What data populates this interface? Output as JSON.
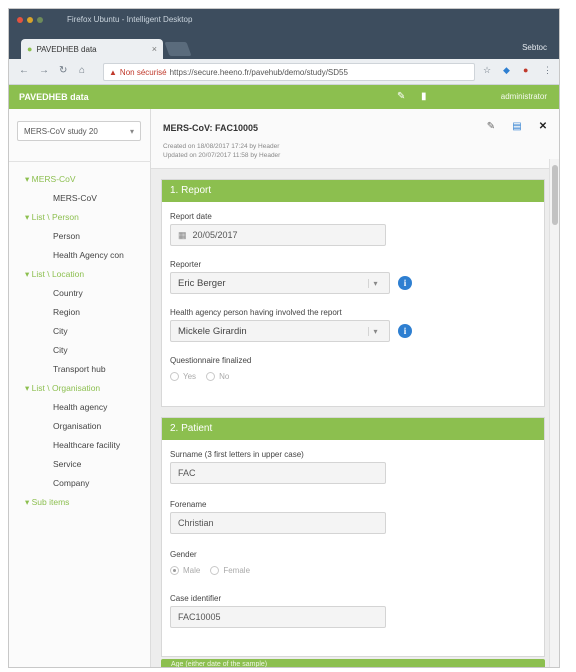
{
  "browser": {
    "window_title": "Firefox Ubuntu - Intelligent Desktop",
    "tab_title": "PAVEDHEB data",
    "profile": "Sebtoc",
    "secure_label": "Non sécurisé",
    "url": "https://secure.heeno.fr/pavehub/demo/study/SD55",
    "colors": {
      "chrome": "#3d4d5e",
      "accent": "#8cbf4f",
      "info": "#2e7fd1"
    }
  },
  "app": {
    "name": "PAVEDHEB data",
    "user": "administrator"
  },
  "sidebar": {
    "study": "MERS-CoV study 20",
    "items": [
      {
        "label": "MERS-CoV",
        "kind": "group"
      },
      {
        "label": "MERS-CoV",
        "kind": "child"
      },
      {
        "label": "List \\ Person",
        "kind": "group"
      },
      {
        "label": "Person",
        "kind": "child"
      },
      {
        "label": "Health Agency con",
        "kind": "child"
      },
      {
        "label": "List \\ Location",
        "kind": "group"
      },
      {
        "label": "Country",
        "kind": "child"
      },
      {
        "label": "Region",
        "kind": "child"
      },
      {
        "label": "City",
        "kind": "child"
      },
      {
        "label": "City",
        "kind": "child"
      },
      {
        "label": "Transport hub",
        "kind": "child"
      },
      {
        "label": "List \\ Organisation",
        "kind": "group"
      },
      {
        "label": "Health agency",
        "kind": "child"
      },
      {
        "label": "Organisation",
        "kind": "child"
      },
      {
        "label": "Healthcare facility",
        "kind": "child"
      },
      {
        "label": "Service",
        "kind": "child"
      },
      {
        "label": "Company",
        "kind": "child"
      },
      {
        "label": "Sub items",
        "kind": "group"
      }
    ]
  },
  "record": {
    "title": "MERS-CoV: FAC10005",
    "created": "Created on 18/08/2017 17:24 by Header",
    "updated": "Updated on 20/07/2017 11:58 by Header",
    "tools": [
      "edit-icon",
      "print-icon",
      "close-icon"
    ]
  },
  "report": {
    "heading": "1. Report",
    "report_date_label": "Report date",
    "report_date": "20/05/2017",
    "reporter_label": "Reporter",
    "reporter": "Eric Berger",
    "health_agency_label": "Health agency person having involved the report",
    "health_agency_person": "Mickele Girardin",
    "finalized_label": "Questionnaire finalized",
    "finalized_options": [
      "Yes",
      "No"
    ]
  },
  "patient": {
    "heading": "2. Patient",
    "surname_label": "Surname (3 first letters in upper case)",
    "surname": "FAC",
    "forename_label": "Forename",
    "forename": "Christian",
    "gender_label": "Gender",
    "gender_options": [
      "Male",
      "Female"
    ],
    "gender_selected": "Male",
    "case_id_label": "Case identifier",
    "case_id": "FAC10005",
    "footer_bar": "Age (either date of the sample)"
  }
}
